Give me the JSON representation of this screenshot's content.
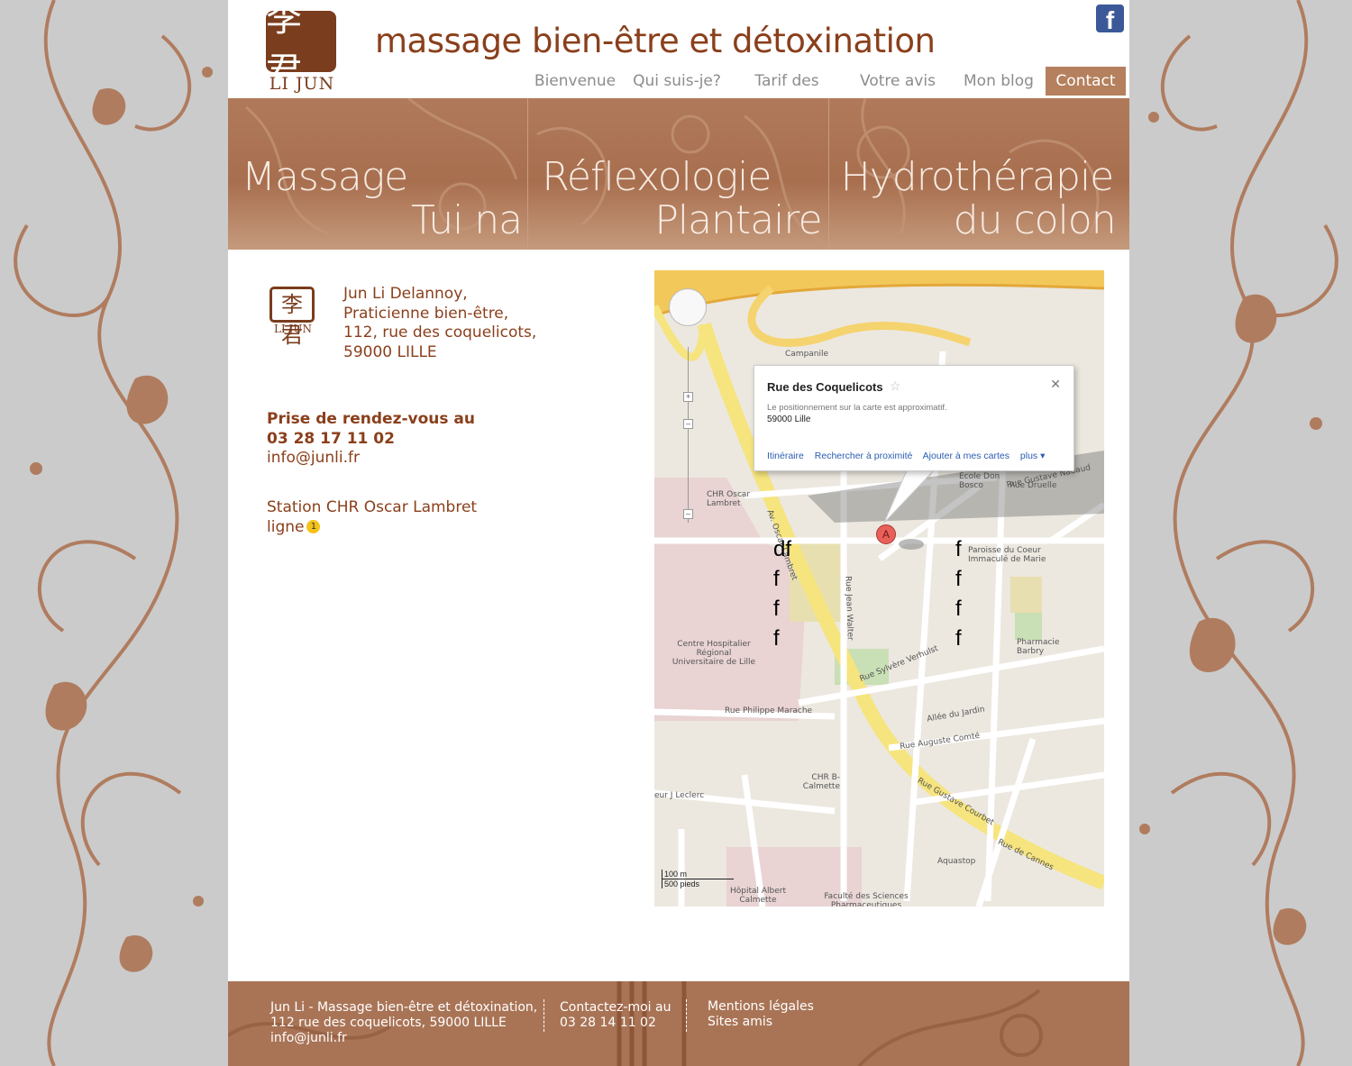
{
  "site": {
    "title": "massage bien-être et détoxination",
    "logo_text": "LI JUN",
    "logo_glyph": "李君",
    "facebook_glyph": "f"
  },
  "nav": {
    "items": [
      {
        "label": "Bienvenue"
      },
      {
        "label": "Qui suis-je?"
      },
      {
        "label": "Tarif des Soins"
      },
      {
        "label": "Votre avis"
      },
      {
        "label": "Mon blog"
      },
      {
        "label": "Contact"
      }
    ],
    "active": "Contact"
  },
  "banners": [
    {
      "line1": "Massage",
      "line2": "Tui na"
    },
    {
      "line1": "Réflexologie",
      "line2": "Plantaire"
    },
    {
      "line1": "Hydrothérapie",
      "line2": "du colon"
    }
  ],
  "contact": {
    "name": "Jun Li Delannoy,",
    "role": "Praticienne bien-être,",
    "street": "112, rue des coquelicots,",
    "city": "59000 LILLE",
    "rdv_label": "Prise de rendez-vous au",
    "phone": "03 28 17 11 02",
    "email": "info@junli.fr",
    "station": "Station CHR Oscar Lambret",
    "line_label": "ligne",
    "line_number": "1"
  },
  "map": {
    "popup": {
      "title": "Rue des Coquelicots",
      "star": "☆",
      "close": "✕",
      "note": "Le positionnement sur la carte est approximatif.",
      "city": "59000 Lille",
      "links": [
        "Itinéraire",
        "Rechercher à proximité",
        "Ajouter à mes cartes",
        "plus ▾"
      ]
    },
    "marker": "A",
    "scale_m": "100 m",
    "scale_ft": "500 pieds",
    "labels": {
      "campanile": "Campanile",
      "chr": "CHR Oscar Lambret",
      "ecole": "École Don Bosco",
      "paroisse": "Paroisse du Coeur Immaculé de Marie",
      "hospital": "Centre Hospitalier Régional Universitaire de Lille",
      "pharmacie": "Pharmacie Barbry",
      "calmette": "CHR B-Calmette",
      "aquastop": "Aquastop",
      "albert": "Hôpital Albert Calmette",
      "faculte": "Faculté des Sciences Pharmaceutiques",
      "marache": "Rue Philippe Marache",
      "jardin": "Allée du Jardin",
      "comte": "Rue Auguste Comté",
      "courbet": "Rue Gustave Courbet",
      "cannes": "Rue de Cannes",
      "nadaud": "Rue Gustave Nadaud",
      "druelle": "Rue Druelle",
      "verhulst": "Rue Sylvère Verhulst",
      "oscar": "Av. Oscar Lambret",
      "walter": "Rue Jean Walter",
      "leclerc": "eur J Leclerc"
    },
    "f_glyphs": [
      "df",
      "f",
      "f",
      "f",
      "f",
      "f",
      "f",
      "f"
    ]
  },
  "footer": {
    "col1": [
      "Jun Li - Massage bien-être et détoxination,",
      "112 rue des coquelicots, 59000 LILLE",
      "info@junli.fr"
    ],
    "col2": [
      "Contactez-moi au",
      "03 28 14 11 02"
    ],
    "col3": [
      "Mentions légales",
      "Sites amis"
    ]
  },
  "colors": {
    "brand": "#8a3f1b",
    "nav_active": "#b5805e",
    "footer_bg": "#a97456",
    "background": "#cbcbcb"
  }
}
